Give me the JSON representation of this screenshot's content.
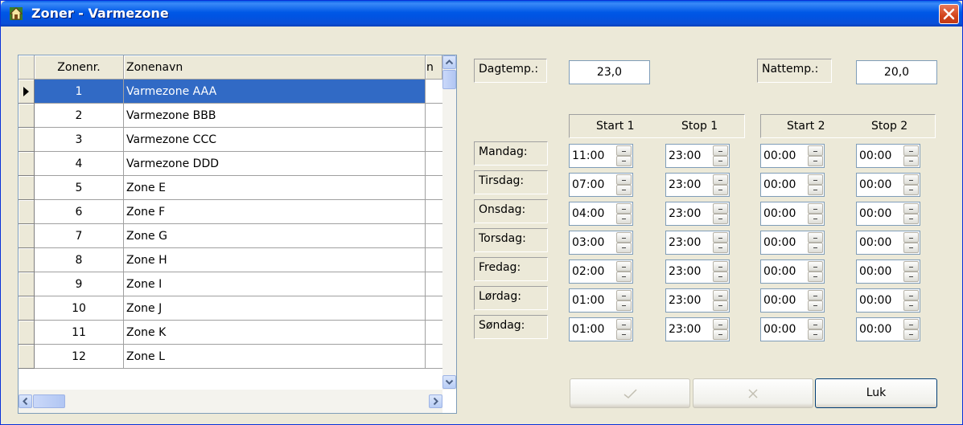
{
  "window": {
    "title": "Zoner - Varmezone"
  },
  "grid": {
    "columns": [
      "Zonenr.",
      "Zonenavn",
      "n"
    ],
    "selected_index": 0,
    "rows": [
      {
        "nr": "1",
        "name": "Varmezone AAA"
      },
      {
        "nr": "2",
        "name": "Varmezone BBB"
      },
      {
        "nr": "3",
        "name": "Varmezone CCC"
      },
      {
        "nr": "4",
        "name": "Varmezone DDD"
      },
      {
        "nr": "5",
        "name": "Zone E"
      },
      {
        "nr": "6",
        "name": "Zone F"
      },
      {
        "nr": "7",
        "name": "Zone G"
      },
      {
        "nr": "8",
        "name": "Zone H"
      },
      {
        "nr": "9",
        "name": "Zone I"
      },
      {
        "nr": "10",
        "name": "Zone J"
      },
      {
        "nr": "11",
        "name": "Zone K"
      },
      {
        "nr": "12",
        "name": "Zone L"
      }
    ]
  },
  "temps": {
    "day_label": "Dagtemp.:",
    "day_value": "23,0",
    "night_label": "Nattemp.:",
    "night_value": "20,0"
  },
  "schedule": {
    "headers": [
      "Start 1",
      "Stop 1",
      "Start 2",
      "Stop 2"
    ],
    "days": [
      {
        "label": "Mandag:",
        "times": [
          "11:00",
          "23:00",
          "00:00",
          "00:00"
        ]
      },
      {
        "label": "Tirsdag:",
        "times": [
          "07:00",
          "23:00",
          "00:00",
          "00:00"
        ]
      },
      {
        "label": "Onsdag:",
        "times": [
          "04:00",
          "23:00",
          "00:00",
          "00:00"
        ]
      },
      {
        "label": "Torsdag:",
        "times": [
          "03:00",
          "23:00",
          "00:00",
          "00:00"
        ]
      },
      {
        "label": "Fredag:",
        "times": [
          "02:00",
          "23:00",
          "00:00",
          "00:00"
        ]
      },
      {
        "label": "Lørdag:",
        "times": [
          "01:00",
          "23:00",
          "00:00",
          "00:00"
        ]
      },
      {
        "label": "Søndag:",
        "times": [
          "01:00",
          "23:00",
          "00:00",
          "00:00"
        ]
      }
    ]
  },
  "buttons": {
    "ok_icon": "check-icon",
    "cancel_icon": "x-icon",
    "close_label": "Luk"
  }
}
